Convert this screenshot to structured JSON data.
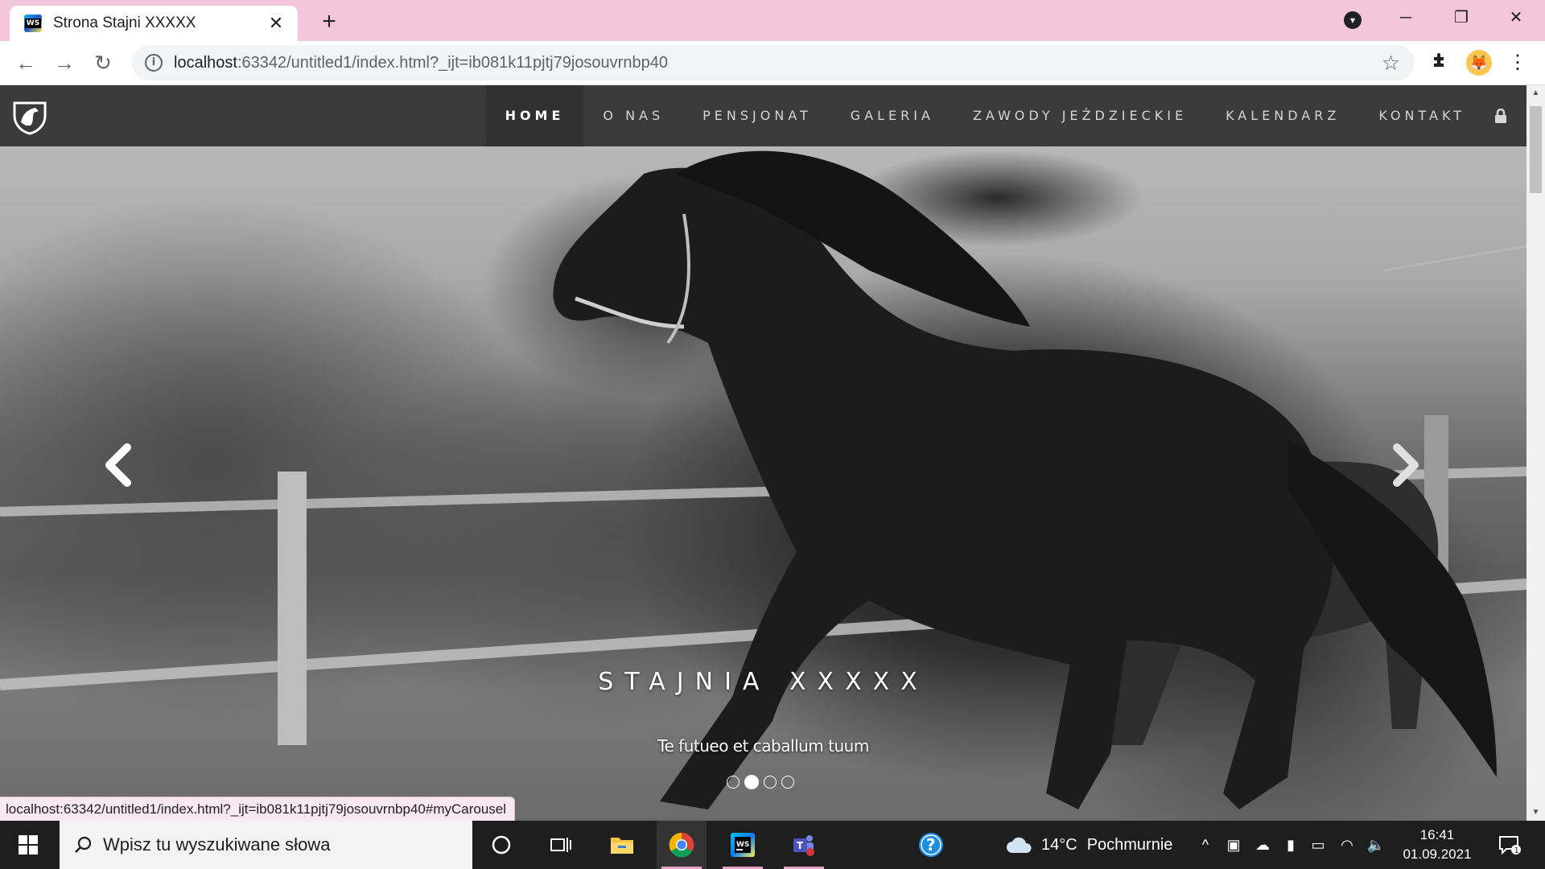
{
  "browser": {
    "tab_title": "Strona Stajni XXXXX",
    "tab_favicon_text": "WS",
    "url_host": "localhost",
    "url_rest": ":63342/untitled1/index.html?_ijt=ib081k11pjtj79josouvrnbp40",
    "status_url": "localhost:63342/untitled1/index.html?_ijt=ib081k11pjtj79josouvrnbp40#myCarousel"
  },
  "site": {
    "nav": [
      {
        "label": "HOME",
        "active": true
      },
      {
        "label": "O NAS"
      },
      {
        "label": "PENSJONAT"
      },
      {
        "label": "GALERIA"
      },
      {
        "label": "ZAWODY JEŹDZIECKIE"
      },
      {
        "label": "KALENDARZ"
      },
      {
        "label": "KONTAKT"
      }
    ],
    "carousel": {
      "title": "STAJNIA XXXXX",
      "subtitle": "Te futueo et caballum tuum",
      "slide_count": 4,
      "active_slide": 2
    }
  },
  "taskbar": {
    "search_placeholder": "Wpisz tu wyszukiwane słowa",
    "weather_temp": "14°C",
    "weather_desc": "Pochmurnie",
    "time": "16:41",
    "date": "01.09.2021",
    "notification_count": "1"
  }
}
